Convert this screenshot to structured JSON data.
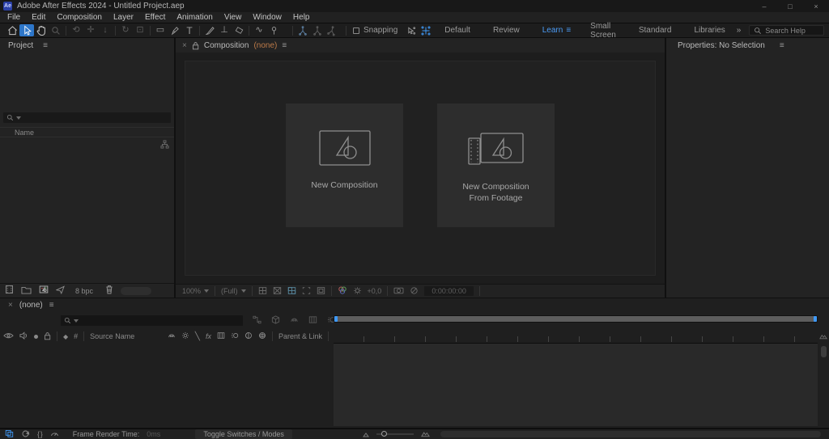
{
  "titlebar": {
    "app_badge": "Ae",
    "title": "Adobe After Effects 2024 - Untitled Project.aep",
    "window_controls": {
      "minimize": "–",
      "maximize": "□",
      "close": "×"
    }
  },
  "menubar": {
    "items": [
      "File",
      "Edit",
      "Composition",
      "Layer",
      "Effect",
      "Animation",
      "View",
      "Window",
      "Help"
    ]
  },
  "toolbar": {
    "snapping_label": "Snapping",
    "overflow_glyph": "»",
    "workspaces": [
      "Default",
      "Review",
      "Learn",
      "Small Screen",
      "Standard",
      "Libraries"
    ],
    "active_workspace": "Learn",
    "search_placeholder": "Search Help"
  },
  "project": {
    "title": "Project",
    "menu_glyph": "≡",
    "name_column": "Name",
    "bit_depth": "8 bpc"
  },
  "composition": {
    "close_glyph": "×",
    "tab_title": "Composition",
    "comp_name": "(none)",
    "comp_name_color": "#bd7b49",
    "menu_glyph": "≡",
    "new_comp": "New Composition",
    "new_comp_footage_1": "New Composition",
    "new_comp_footage_2": "From Footage",
    "zoom": "100%",
    "resolution": "(Full)",
    "exposure_offset": "+0,0",
    "timecode": "0:00:00:00"
  },
  "properties": {
    "title": "Properties: No Selection",
    "menu_glyph": "≡"
  },
  "timeline": {
    "close_glyph": "×",
    "tab_name": "(none)",
    "menu_glyph": "≡",
    "hash_column": "#",
    "source_name_column": "Source Name",
    "parent_link_column": "Parent & Link",
    "fx_label": "fx"
  },
  "statusbar": {
    "frame_render_label": "Frame Render Time:",
    "frame_render_value": "0ms",
    "toggle_switches_label": "Toggle Switches / Modes"
  },
  "colors": {
    "accent_blue": "#3f99f7",
    "workspace_active": "#4b9bf5"
  }
}
